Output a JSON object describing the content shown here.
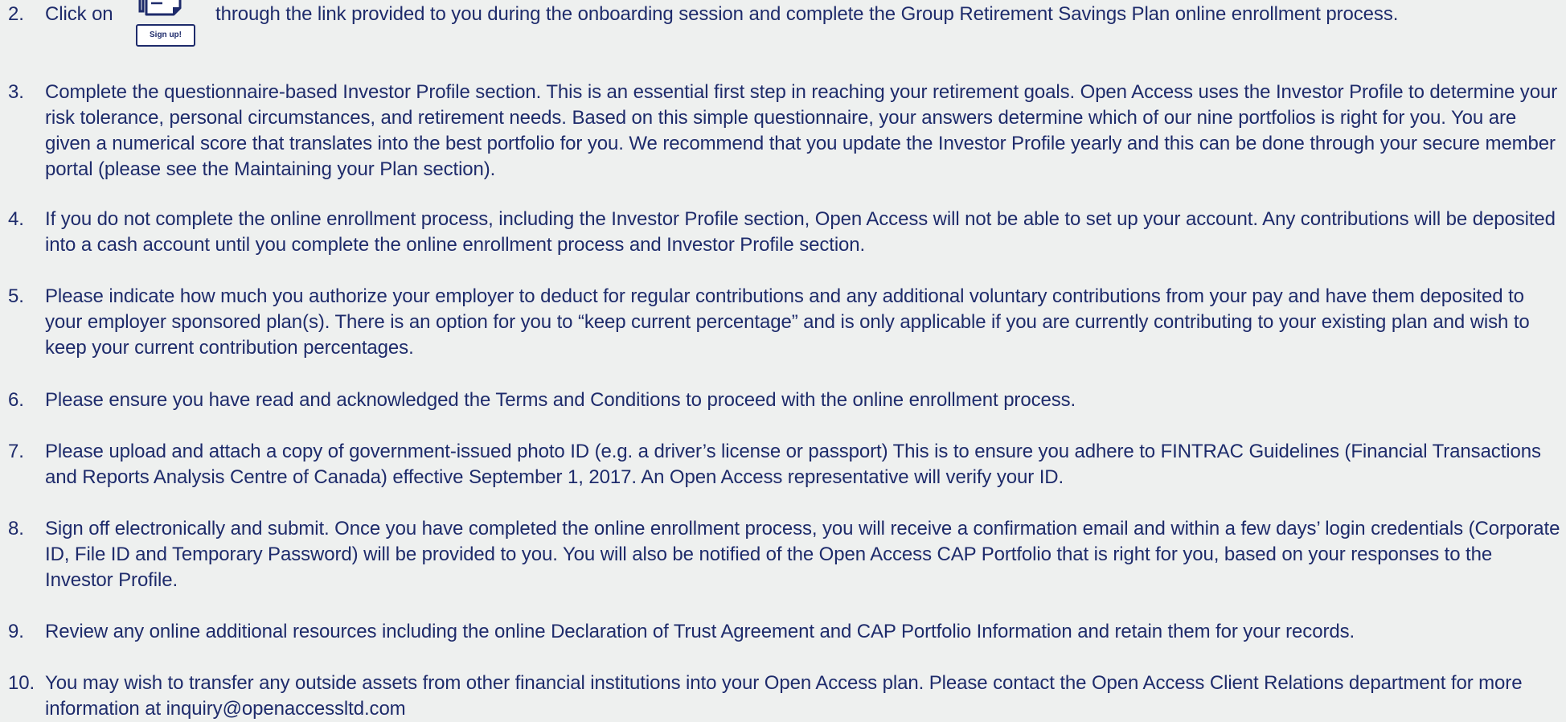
{
  "steps": [
    {
      "number": "2.",
      "text_before": "Click on",
      "icon_label": "Sign up!",
      "text_after": "through the link provided to you during the onboarding session and complete the Group Retirement Savings Plan online enrollment process."
    },
    {
      "number": "3.",
      "text": "Complete the questionnaire-based Investor Profile section. This is an essential first step in reaching your retirement goals. Open Access uses the Investor Profile to determine your risk tolerance, personal circumstances, and retirement needs. Based on this simple questionnaire, your answers determine which of our nine portfolios is right for you. You are given a numerical score that translates into the best portfolio for you. We recommend that you update the Investor Profile yearly and this can be done through your secure member portal (please see the Maintaining your Plan section)."
    },
    {
      "number": "4.",
      "text": "If you do not complete the online enrollment process, including the Investor Profile section, Open Access will not be able to set up your account. Any contributions will be deposited into a cash account until you complete the online enrollment process and Investor Profile section."
    },
    {
      "number": "5.",
      "text": "Please indicate how much you authorize your employer to deduct for regular contributions and any additional voluntary contributions from your pay and have them deposited to your employer sponsored plan(s). There is an option for you to “keep current percentage” and is only applicable if you are currently contributing to your existing plan and wish to keep your current contribution percentages."
    },
    {
      "number": "6.",
      "text": "Please ensure you have read and acknowledged the Terms and Conditions to proceed with the online enrollment process."
    },
    {
      "number": "7.",
      "text": "Please upload and attach a copy of government-issued photo ID (e.g. a driver’s license or passport) This is to ensure you adhere to FINTRAC Guidelines (Financial Transactions and Reports Analysis Centre of Canada) effective September 1, 2017. An Open Access representative will verify your ID."
    },
    {
      "number": "8.",
      "text": "Sign off electronically and submit. Once you have completed the online enrollment process, you will receive a confirmation email and within a few days’ login credentials (Corporate ID, File ID and Temporary Password)  will be provided to you. You will also be notified of the Open Access CAP Portfolio that is right for you, based on your responses to the Investor Profile."
    },
    {
      "number": "9.",
      "text": "Review any online additional resources including the online Declaration of Trust Agreement and CAP Portfolio Information and retain them for your records."
    },
    {
      "number": "10.",
      "text": "You may wish to transfer any outside assets from other financial institutions into your Open Access plan. Please contact the Open Access Client Relations department for more information at  inquiry@openaccessltd.com"
    }
  ],
  "colors": {
    "text": "#1e2b6b",
    "background": "#eef0ef"
  }
}
